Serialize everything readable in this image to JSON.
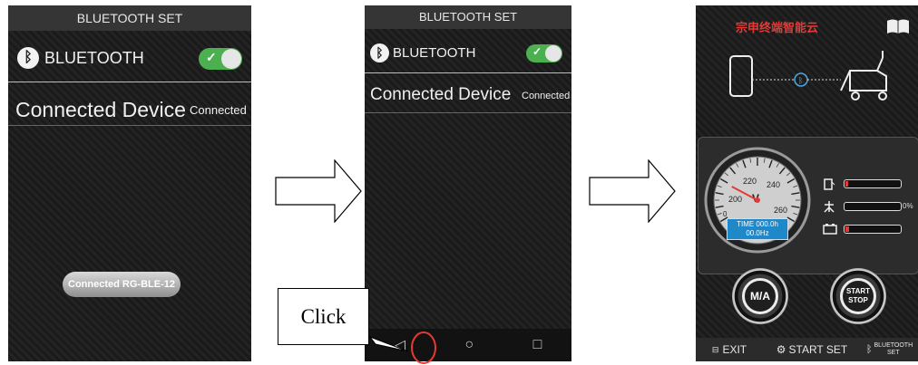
{
  "screen1": {
    "header_title": "BLUETOOTH SET",
    "bluetooth_label": "BLUETOOTH",
    "connected_device_label": "Connected Device",
    "connected_status": "Connected",
    "device_pill": "Connected RG-BLE-12"
  },
  "screen2": {
    "header_title": "BLUETOOTH SET",
    "bluetooth_label": "BLUETOOTH",
    "connected_device_label": "Connected Device",
    "connected_status": "Connected",
    "nav_back": "◁",
    "nav_home": "○",
    "nav_recent": "□"
  },
  "callout": {
    "text": "Click"
  },
  "screen3": {
    "title": "宗申终端智能云",
    "gauge": {
      "ticks": [
        "200",
        "220",
        "240",
        "260",
        "0"
      ],
      "unit": "V",
      "time_readout": "TIME 000.0h",
      "hz_readout": "00.0Hz",
      "needle_angle_deg": 208
    },
    "bars": [
      {
        "icon": "fuel-icon",
        "level": 0.05
      },
      {
        "icon": "load-icon",
        "level": 0.0,
        "percent_label": "0%"
      },
      {
        "icon": "battery-icon",
        "level": 0.06
      }
    ],
    "ma_button": "M/A",
    "start_button_line1": "START",
    "start_button_line2": "STOP",
    "bottom": {
      "exit": "EXIT",
      "start_set": "START SET",
      "bt_set_line1": "BLUETOOTH",
      "bt_set_line2": "SET"
    }
  },
  "colors": {
    "toggle_on": "#4caf50",
    "alert_red": "#e53935",
    "readout_blue": "#1e88c8"
  }
}
